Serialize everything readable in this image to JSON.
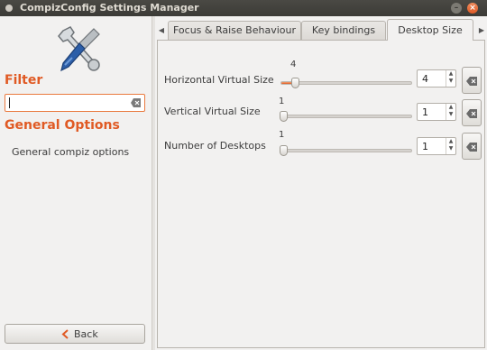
{
  "window": {
    "title": "CompizConfig Settings Manager",
    "minimize_glyph": "–",
    "close_glyph": "×"
  },
  "sidebar": {
    "logo_icon": "tools-wrench-screwdriver-icon",
    "filter_heading": "Filter",
    "filter_value": "",
    "general_heading": "General Options",
    "general_item": "General compiz options",
    "back_label": "Back"
  },
  "tabs": [
    {
      "label": "Focus & Raise Behaviour",
      "active": false
    },
    {
      "label": "Key bindings",
      "active": false
    },
    {
      "label": "Desktop Size",
      "active": true
    }
  ],
  "settings": [
    {
      "label": "Horizontal Virtual Size",
      "value": "4",
      "slider_value": 4,
      "slider_min": 1,
      "slider_max": 32
    },
    {
      "label": "Vertical Virtual Size",
      "value": "1",
      "slider_value": 1,
      "slider_min": 1,
      "slider_max": 32
    },
    {
      "label": "Number of Desktops",
      "value": "1",
      "slider_value": 1,
      "slider_min": 1,
      "slider_max": 36
    }
  ],
  "colors": {
    "accent": "#e05a24",
    "titlebar": "#3c3b37",
    "background": "#f2f1f0"
  }
}
